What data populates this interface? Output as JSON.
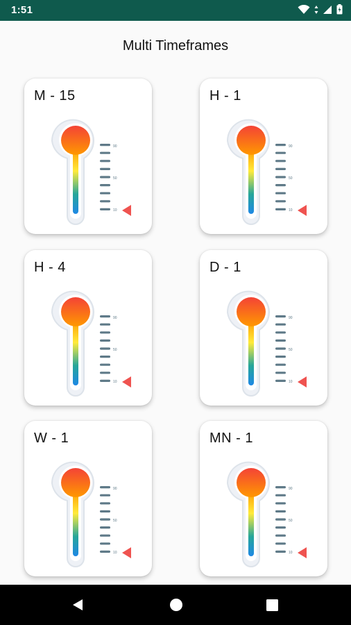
{
  "status": {
    "time": "1:51"
  },
  "title": "Multi Timeframes",
  "cards": [
    {
      "label": "M - 15"
    },
    {
      "label": "H - 1"
    },
    {
      "label": "H - 4"
    },
    {
      "label": "D - 1"
    },
    {
      "label": "W - 1"
    },
    {
      "label": "MN - 1"
    }
  ],
  "gauge": {
    "scale_labels": [
      "90",
      "50",
      "10"
    ]
  },
  "colors": {
    "status_bar": "#0f5a4d",
    "indicator": "#ef5350",
    "thermo_gradient": [
      "#f44336",
      "#ff9800",
      "#ffeb3b",
      "#26a69a",
      "#1e88e5"
    ]
  }
}
